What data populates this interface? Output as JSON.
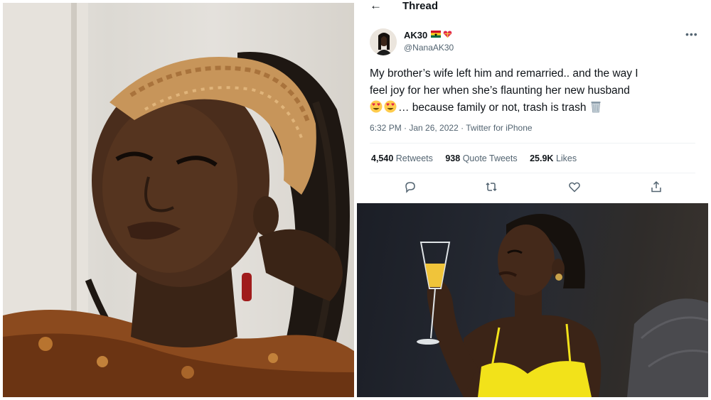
{
  "header": {
    "back_icon": "arrow-left-icon",
    "title": "Thread"
  },
  "author": {
    "display_name": "AK30",
    "handle": "@NanaAK30",
    "badges": [
      "ghana-flag-icon",
      "gift-heart-icon"
    ]
  },
  "tweet": {
    "line1": "My brother’s wife left him and remarried.. and the way I",
    "line2": "feel joy for her when she’s flaunting her new husband",
    "line3": "… because family or not, trash is trash",
    "emojis": [
      "heart-eyes-emoji-icon",
      "heart-eyes-emoji-icon",
      "wastebasket-emoji-icon"
    ],
    "timestamp": "6:32 PM · Jan 26, 2022 · Twitter for iPhone"
  },
  "stats": {
    "retweets_count": "4,540",
    "retweets_label": "Retweets",
    "quotes_count": "938",
    "quotes_label": "Quote Tweets",
    "likes_count": "25.9K",
    "likes_label": "Likes"
  },
  "actions": [
    "reply-icon",
    "retweet-icon",
    "like-icon",
    "share-icon"
  ],
  "colors": {
    "text": "#0f1419",
    "muted": "#536471",
    "divider": "#eff3f4"
  }
}
